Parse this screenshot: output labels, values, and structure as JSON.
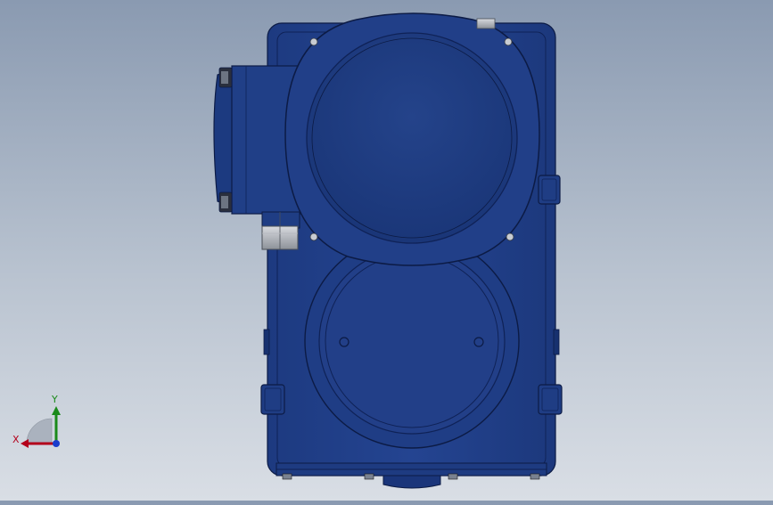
{
  "view": {
    "background_top": "#8a9ab1",
    "background_bottom": "#d9dee5",
    "part_color": "#1f3f86",
    "part_dark": "#12265a",
    "part_light": "#2e4f9a"
  },
  "triad": {
    "x_label": "X",
    "y_label": "Y",
    "x_color": "#b3001b",
    "y_color": "#1a8a1a",
    "z_color": "#1a3ccc"
  }
}
